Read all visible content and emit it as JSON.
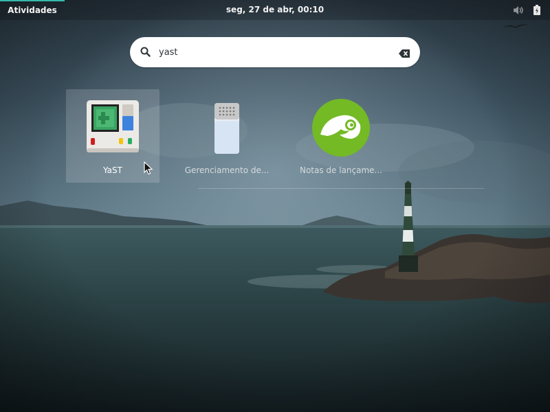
{
  "topbar": {
    "activities_label": "Atividades",
    "clock": "seg, 27 de abr, 00:10",
    "icons": [
      "volume-muted-icon",
      "battery-icon"
    ]
  },
  "search": {
    "value": "yast",
    "placeholder": "",
    "icon": "search-icon",
    "clear_icon": "clear-icon"
  },
  "results": [
    {
      "label": "YaST",
      "icon": "yast-icon",
      "selected": true
    },
    {
      "label": "Gerenciamento de...",
      "icon": "software-management-icon",
      "selected": false
    },
    {
      "label": "Notas de lançame...",
      "icon": "opensuse-release-notes-icon",
      "selected": false
    }
  ],
  "colors": {
    "accent": "#35b9ab",
    "search_bg": "#ffffff",
    "opensuse_green": "#73ba25"
  }
}
